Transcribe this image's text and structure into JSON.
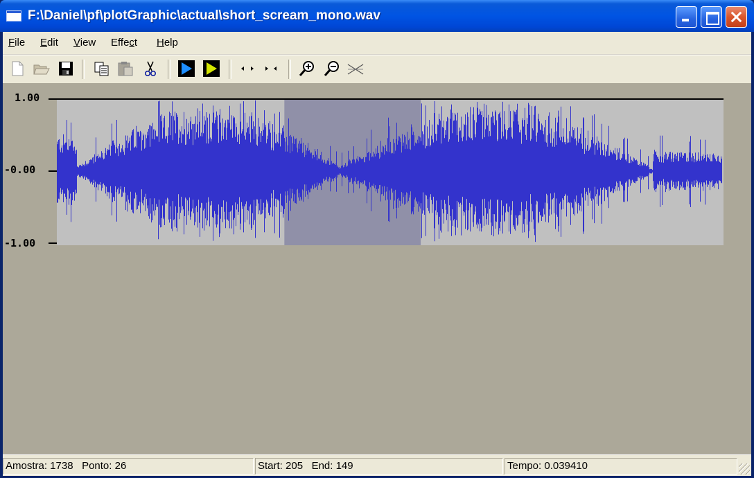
{
  "window": {
    "title": "F:\\Daniel\\pf\\plotGraphic\\actual\\short_scream_mono.wav"
  },
  "menu": {
    "items": [
      {
        "pre": "",
        "u": "F",
        "post": "ile"
      },
      {
        "pre": "",
        "u": "E",
        "post": "dit"
      },
      {
        "pre": "",
        "u": "V",
        "post": "iew"
      },
      {
        "pre": "Effe",
        "u": "c",
        "post": "t"
      },
      {
        "pre": "",
        "u": "H",
        "post": "elp"
      }
    ]
  },
  "toolbar": {
    "icons": [
      "new-icon",
      "open-icon",
      "save-icon",
      "copy-icon",
      "paste-icon",
      "cut-icon",
      "play-icon",
      "play-selection-icon",
      "expand-selection-icon",
      "shrink-selection-icon",
      "zoom-in-icon",
      "zoom-out-icon",
      "zoom-reset-icon"
    ]
  },
  "plot": {
    "y_ticks": [
      "1.00",
      "-0.00",
      "-1.00"
    ],
    "waveform_color": "#3333CC",
    "background_color": "#C0C0C0",
    "selection_color": "#9090A8",
    "selection": {
      "start_fraction": 0.342,
      "end_fraction": 0.547
    }
  },
  "status": {
    "amostra": "Amostra: 1738",
    "ponto": "Ponto: 26",
    "start": "Start: 205",
    "end": "End: 149",
    "tempo": "Tempo: 0.039410"
  }
}
